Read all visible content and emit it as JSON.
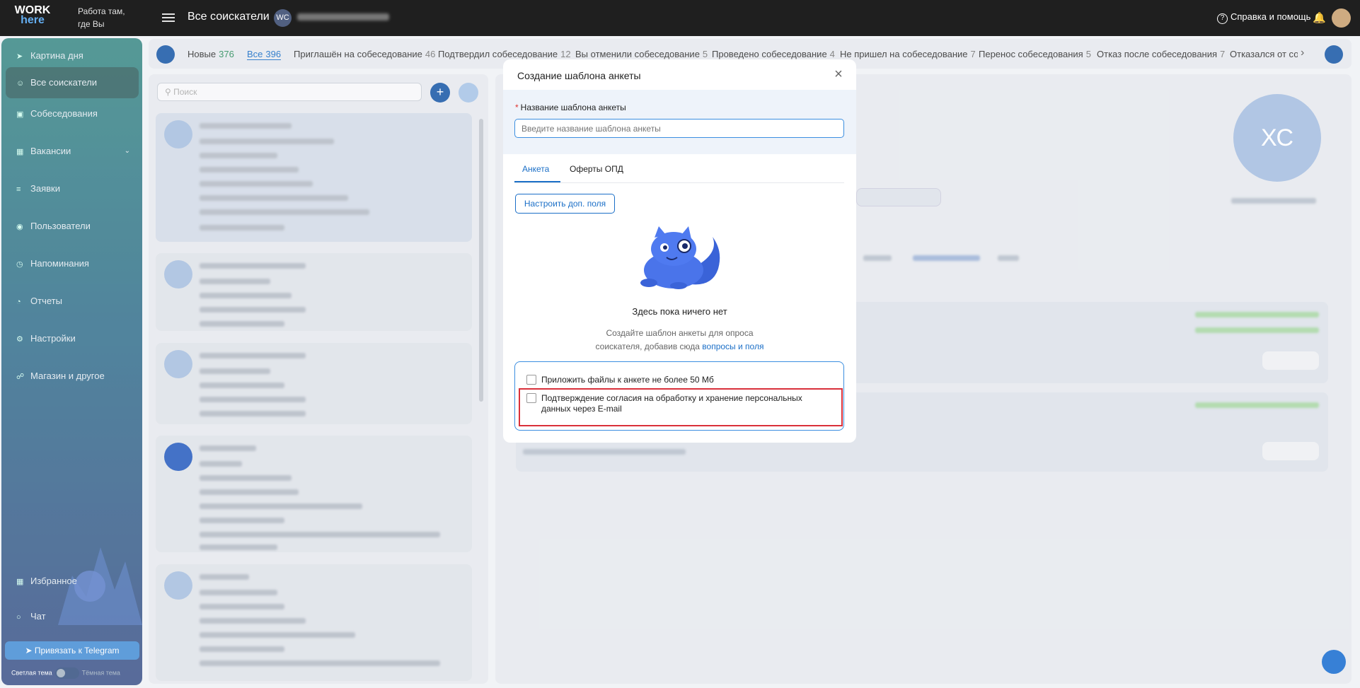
{
  "app": {
    "logo_line1": "WORK",
    "logo_line2": "here",
    "slogan_line1": "Работа там,",
    "slogan_line2": "где Вы",
    "page_title": "Все соискатели",
    "org_initials": "WC",
    "help_label": "Справка и помощь"
  },
  "sidebar": {
    "items": [
      {
        "label": "Картина дня",
        "icon": "rocket-icon"
      },
      {
        "label": "Все соискатели",
        "icon": "users-icon"
      },
      {
        "label": "Собеседования",
        "icon": "calendar-icon"
      },
      {
        "label": "Вакансии",
        "icon": "briefcase-icon"
      },
      {
        "label": "Заявки",
        "icon": "list-icon"
      },
      {
        "label": "Пользователи",
        "icon": "user-circle-icon"
      },
      {
        "label": "Напоминания",
        "icon": "alarm-icon"
      },
      {
        "label": "Отчеты",
        "icon": "pie-icon"
      },
      {
        "label": "Настройки",
        "icon": "gear-icon"
      },
      {
        "label": "Магазин и другое",
        "icon": "cart-icon"
      },
      {
        "label": "Избранное",
        "icon": "grid-icon"
      },
      {
        "label": "Чат",
        "icon": "chat-icon"
      }
    ],
    "telegram_button": "Привязать к Telegram",
    "theme_light": "Светлая тема",
    "theme_dark": "Тёмная тема"
  },
  "tabs": [
    {
      "label": "Новые",
      "count": "376"
    },
    {
      "label": "Все",
      "count": "396"
    },
    {
      "label": "Приглашён на собеседование",
      "count": "46"
    },
    {
      "label": "Подтвердил собеседование",
      "count": "12"
    },
    {
      "label": "Вы отменили собеседование",
      "count": "5"
    },
    {
      "label": "Проведено собеседование",
      "count": "4"
    },
    {
      "label": "Не пришел на собеседование",
      "count": "7"
    },
    {
      "label": "Перенос собеседования",
      "count": "5"
    },
    {
      "label": "Отказ после собеседования",
      "count": "7"
    },
    {
      "label": "Отказался от соб",
      "count": ""
    }
  ],
  "search": {
    "placeholder": "Поиск"
  },
  "candidate_initials": "ХС",
  "modal": {
    "title": "Создание шаблона анкеты",
    "name_label": "Название шаблона анкеты",
    "name_placeholder": "Введите название шаблона анкеты",
    "name_value": "",
    "tabs": [
      {
        "label": "Анкета"
      },
      {
        "label": "Оферты ОПД"
      }
    ],
    "configure_button": "Настроить доп. поля",
    "empty_title": "Здесь пока ничего нет",
    "empty_desc_line1": "Создайте шаблон анкеты для опроса",
    "empty_desc_line2": "соискателя, добавив сюда",
    "empty_desc_link": "вопросы и поля",
    "options": [
      {
        "label": "Приложить файлы к анкете не более 50 Мб",
        "checked": false
      },
      {
        "label": "Подтверждение согласия на обработку и хранение персональных данных через E-mail",
        "checked": false
      }
    ]
  },
  "colors": {
    "accent": "#1b6fc7",
    "required": "#e0342f",
    "highlight": "#d9303a",
    "count_green": "#2f8f5f"
  }
}
